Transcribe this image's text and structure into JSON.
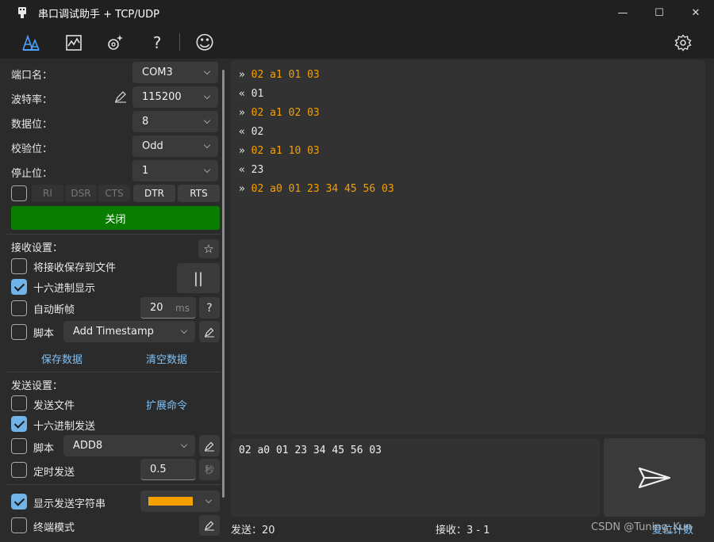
{
  "window": {
    "title": "串口调试助手 + TCP/UDP",
    "minimize_glyph": "—",
    "maximize_glyph": "☐",
    "close_glyph": "✕"
  },
  "toolbar": {
    "icons": [
      "text-mode-icon",
      "chart-icon",
      "sparkle-settings-icon",
      "help-icon",
      "smiley-icon",
      "gear-icon"
    ],
    "help_glyph": "?",
    "smiley_glyph": "☺"
  },
  "serial": {
    "port_label": "端口名：",
    "port_value": "COM3",
    "baud_label": "波特率：",
    "baud_value": "115200",
    "databits_label": "数据位：",
    "databits_value": "8",
    "parity_label": "校验位：",
    "parity_value": "Odd",
    "stopbits_label": "停止位：",
    "stopbits_value": "1",
    "signals": [
      "RI",
      "DSR",
      "CTS",
      "DTR",
      "RTS"
    ],
    "close_button": "关闭"
  },
  "receive": {
    "section_label": "接收设置：",
    "save_to_file": "将接收保存到文件",
    "hex_display": "十六进制显示",
    "auto_frame": "自动断帧",
    "auto_frame_value": "20",
    "auto_frame_unit": "ms",
    "help_glyph": "?",
    "script_label": "脚本",
    "script_value": "Add Timestamp",
    "save_data": "保存数据",
    "clear_data": "清空数据",
    "pause_glyph": "||",
    "star_glyph": "☆"
  },
  "send": {
    "section_label": "发送设置：",
    "send_file": "发送文件",
    "ext_commands": "扩展命令",
    "hex_send": "十六进制发送",
    "script_label": "脚本",
    "script_value": "ADD8",
    "timed_send": "定时发送",
    "timed_value": "0.5",
    "timed_unit": "秒",
    "show_send_string": "显示发送字符串",
    "terminal_mode": "终端模式",
    "input_text": "02 a0 01 23 34 45 56 03"
  },
  "log": [
    {
      "dir": "»",
      "text": "02 a1 01 03",
      "type": "tx"
    },
    {
      "dir": "«",
      "text": "01",
      "type": "rx"
    },
    {
      "dir": "»",
      "text": "02 a1 02 03",
      "type": "tx"
    },
    {
      "dir": "«",
      "text": "02",
      "type": "rx"
    },
    {
      "dir": "»",
      "text": "02 a1 10 03",
      "type": "tx"
    },
    {
      "dir": "«",
      "text": "23",
      "type": "rx"
    },
    {
      "dir": "»",
      "text": "02 a0 01 23 34 45 56 03",
      "type": "tx"
    }
  ],
  "status": {
    "sent": "发送：20",
    "received": "接收：3 - 1",
    "reset": "复位计数"
  },
  "watermark": "CSDN @Tuning_Kun",
  "colors": {
    "accent": "#4aa3ff",
    "tx_color": "#f6a000",
    "close_button_bg": "#0a7d00",
    "send_string_color": "#f6a000"
  }
}
